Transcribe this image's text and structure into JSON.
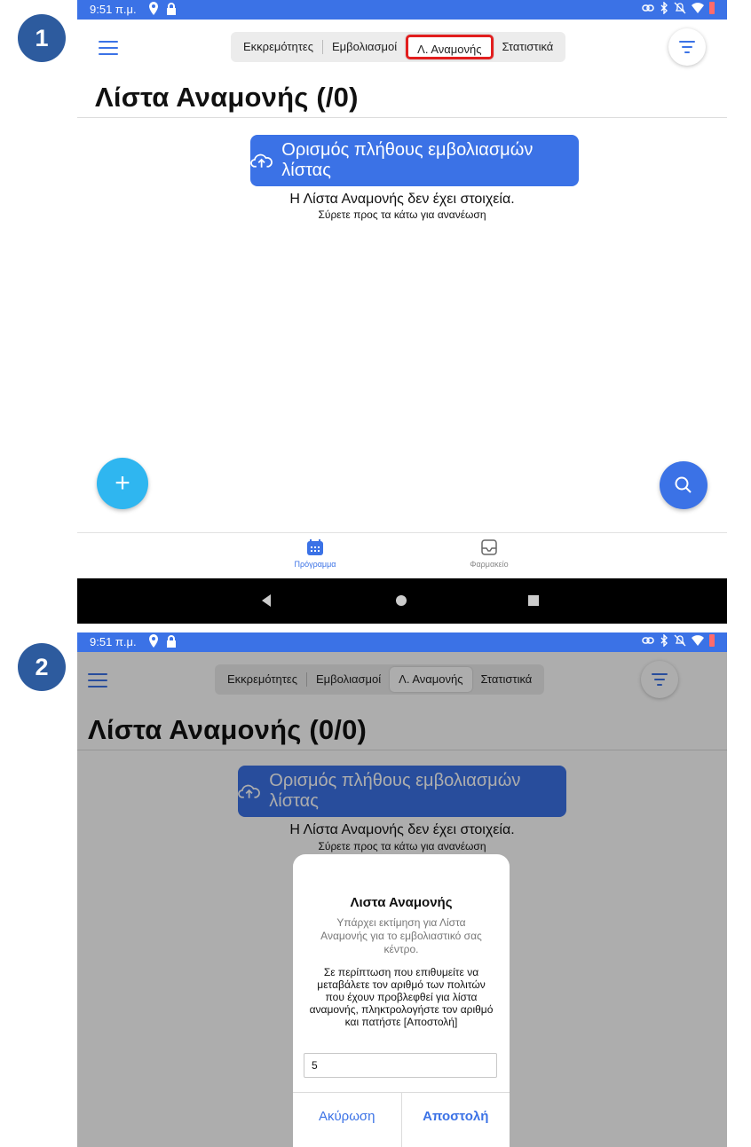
{
  "step_badges": [
    "1",
    "2"
  ],
  "status_bar": {
    "time": "9:51 π.μ."
  },
  "segments": [
    "Εκκρεμότητες",
    "Εμβολιασμοί",
    "Λ. Αναμονής",
    "Στατιστικά"
  ],
  "screen1": {
    "page_title": "Λίστα Αναμονής (/0)",
    "primary_button": "Ορισμός πλήθους εμβολιασμών λίστας",
    "empty_message": "Η Λίστα Αναμονής δεν έχει στοιχεία.",
    "empty_hint": "Σύρετε προς τα κάτω για ανανέωση",
    "fab_add": "+",
    "bottom_tabs": {
      "program": "Πρόγραμμα",
      "pharmacy": "Φαρμακείο"
    }
  },
  "screen2": {
    "segments": [
      "Εκκρεμότητες",
      "Εμβολιασμοί",
      "Λ. Αναμονής",
      "Στατιστικά"
    ],
    "page_title": "Λίστα Αναμονής (0/0)",
    "primary_button": "Ορισμός πλήθους εμβολιασμών λίστας",
    "empty_message": "Η Λίστα Αναμονής δεν έχει στοιχεία.",
    "empty_hint": "Σύρετε προς τα κάτω για ανανέωση",
    "dialog": {
      "title": "Λιστα Αναμονής",
      "message": "Υπάρχει εκτίμηση για Λίστα Αναμονής για το εμβολιαστικό σας κέντρο.",
      "note": "Σε περίπτωση που επιθυμείτε να μεταβάλετε τον αριθμό των πολιτών που έχουν προβλεφθεί για λίστα αναμονής, πληκτρολογήστε τον αριθμό και πατήστε [Αποστολή]",
      "input_value": "5",
      "cancel_label": "Ακύρωση",
      "submit_label": "Αποστολή"
    }
  },
  "colors": {
    "accent": "#3b72e6",
    "fab_add": "#2fb6f0",
    "highlight": "#e21e1e",
    "badge": "#2d5b9e"
  }
}
